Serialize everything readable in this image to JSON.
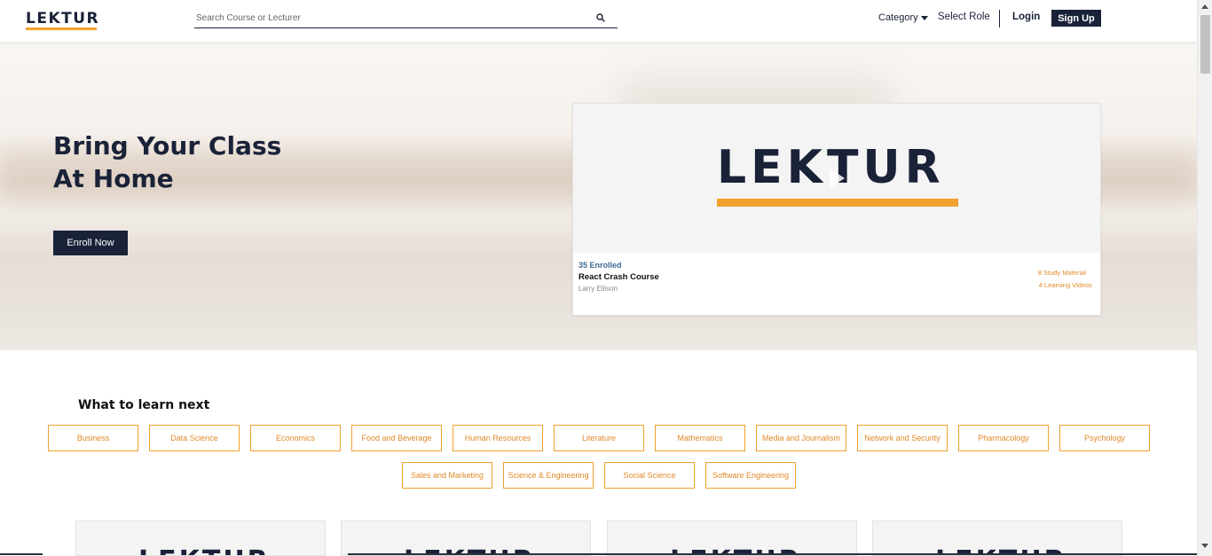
{
  "header": {
    "logo": "LEKTUR",
    "search_placeholder": "Search Course or Lecturer",
    "category_label": "Category",
    "select_role_label": "Select Role",
    "login_label": "Login",
    "signup_label": "Sign Up"
  },
  "hero": {
    "title_line1": "Bring Your Class",
    "title_line2": "At Home",
    "enroll_label": "Enroll Now"
  },
  "featured_course": {
    "thumbnail_text": "LEKTUR",
    "enrolled": "35 Enrolled",
    "title": "React Crash Course",
    "author": "Larry Ellison",
    "study_material": "8 Study Material",
    "learning_videos": "4 Learning Videos"
  },
  "learn_next": {
    "title": "What to learn next",
    "categories": [
      "Business",
      "Data Science",
      "Economics",
      "Food and Beverage",
      "Human Resources",
      "Literature",
      "Mathematics",
      "Media and Journalism",
      "Network and Security",
      "Pharmacology",
      "Psychology",
      "Sales and Marketing",
      "Science & Engineering",
      "Social Science",
      "Software Engineering"
    ]
  },
  "course_cards": {
    "thumbnail_text": "LEKTUR"
  },
  "colors": {
    "brand_navy": "#1a2238",
    "accent_orange": "#f0a12e",
    "enrolled_blue": "#3e6a92"
  },
  "icons": [
    "search-icon",
    "chevron-down-icon",
    "play-icon"
  ]
}
